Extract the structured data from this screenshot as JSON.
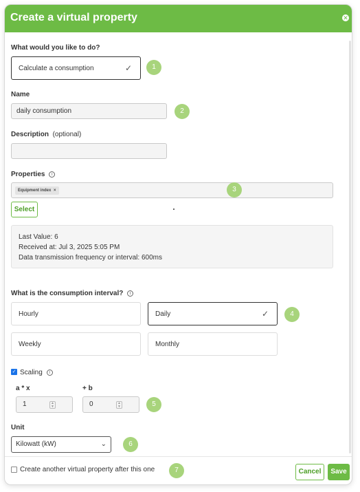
{
  "dialog": {
    "title": "Create a virtual property"
  },
  "action": {
    "question": "What would you like to do?",
    "value": "Calculate a consumption"
  },
  "name": {
    "label": "Name",
    "value": "daily consumption"
  },
  "description": {
    "label": "Description",
    "optional": "(optional)",
    "value": ""
  },
  "properties": {
    "label": "Properties",
    "chips": [
      "Equipment index"
    ],
    "select_label": "Select"
  },
  "info": {
    "last_value": "Last Value: 6",
    "received": "Received at: Jul 3, 2025 5:05 PM",
    "frequency": "Data transmission frequency or interval: 600ms"
  },
  "interval": {
    "question": "What is the consumption interval?",
    "options": [
      "Hourly",
      "Daily",
      "Weekly",
      "Monthly"
    ],
    "selected": "Daily"
  },
  "scaling": {
    "label": "Scaling",
    "checked": true,
    "a_label": "a * x",
    "a_value": "1",
    "b_label": "+ b",
    "b_value": "0"
  },
  "unit": {
    "label": "Unit",
    "value": "Kilowatt (kW)"
  },
  "footer": {
    "create_another": "Create another virtual property after this one",
    "cancel_label": "Cancel",
    "save_label": "Save"
  },
  "steps": [
    "1",
    "2",
    "3",
    "4",
    "5",
    "6",
    "7"
  ],
  "colors": {
    "accent": "#6dbb45",
    "badge": "#a8d47c",
    "checkbox": "#1a73e8"
  }
}
